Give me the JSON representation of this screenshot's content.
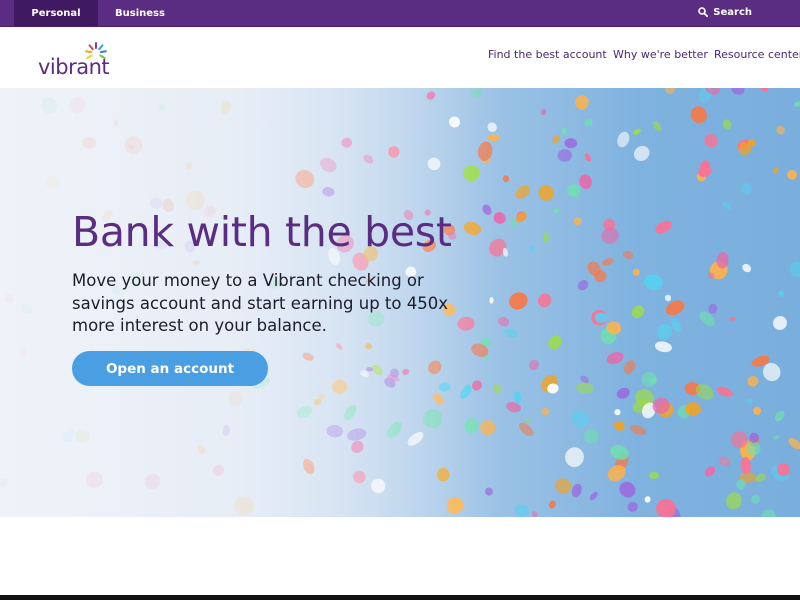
{
  "topbar": {
    "tabs": [
      {
        "label": "Personal",
        "active": true
      },
      {
        "label": "Business",
        "active": false
      }
    ],
    "search_label": "Search"
  },
  "header": {
    "logo_text": "vibrant",
    "nav": [
      {
        "label": "Find the best account"
      },
      {
        "label": "Why we're better"
      },
      {
        "label": "Resource center"
      }
    ]
  },
  "hero": {
    "title": "Bank with the best",
    "subtitle": "Move your money to a Vibrant checking or savings account and start earning up to 450x more interest on your balance.",
    "cta_label": "Open an account"
  },
  "colors": {
    "brand_purple": "#5b2d82",
    "topbar_active": "#3f1a62",
    "cta_blue": "#4a9fe3"
  },
  "icons": {
    "search": "search-icon",
    "logo_burst": "logo-burst-icon"
  }
}
